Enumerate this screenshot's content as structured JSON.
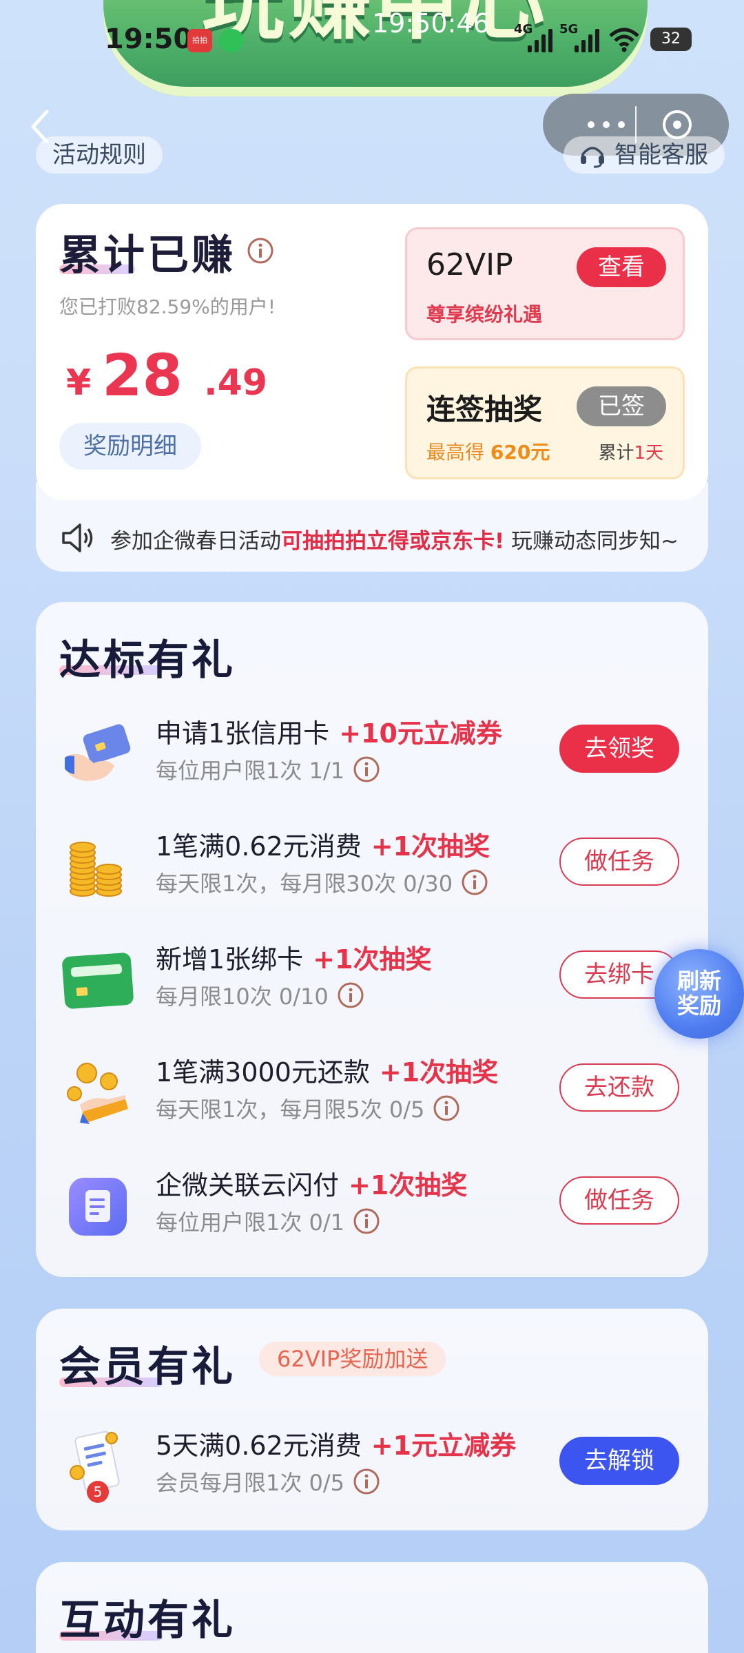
{
  "banner": {
    "title": "玩赚中心"
  },
  "status_bar": {
    "time": "19:50",
    "center_time": "19:50:46",
    "network_a": "4G",
    "network_b": "5G",
    "battery": "32",
    "app_badge_text": "拍拍"
  },
  "header": {
    "rules_label": "活动规则",
    "service_label": "智能客服"
  },
  "summary": {
    "title": "累计已赚",
    "beat_text": "您已打败82.59%的用户!",
    "currency": "¥",
    "amount_int": "28",
    "amount_dec": ".49",
    "detail_label": "奖励明细",
    "vip": {
      "name": "62VIP",
      "subtitle": "尊享缤纷礼遇",
      "button": "查看"
    },
    "sign": {
      "name": "连签抽奖",
      "button": "已签",
      "sub_prefix": "最高得",
      "sub_value": "620元",
      "total_prefix": "累计",
      "total_value": "1天"
    }
  },
  "notice": {
    "prefix": "参加企微春日活动",
    "highlight": "可抽拍拍立得或京东卡!",
    "suffix": "玩赚动态同步知~"
  },
  "standard": {
    "title": "达标有礼",
    "tasks": [
      {
        "title": "申请1张信用卡",
        "reward": "+10元立减券",
        "sub": "每位用户限1次 1/1",
        "button": "去领奖",
        "icon": "credit-card-hand-icon"
      },
      {
        "title": "1笔满0.62元消费",
        "reward": "+1次抽奖",
        "sub": "每天限1次，每月限30次 0/30",
        "button": "做任务",
        "icon": "gold-coins-icon"
      },
      {
        "title": "新增1张绑卡",
        "reward": "+1次抽奖",
        "sub": "每月限10次 0/10",
        "button": "去绑卡",
        "icon": "green-card-icon"
      },
      {
        "title": "1笔满3000元还款",
        "reward": "+1次抽奖",
        "sub": "每天限1次，每月限5次 0/5",
        "button": "去还款",
        "icon": "coin-hand-icon"
      },
      {
        "title": "企微关联云闪付",
        "reward": "+1次抽奖",
        "sub": "每位用户限1次 0/1",
        "button": "做任务",
        "icon": "document-app-icon"
      }
    ]
  },
  "refresh": {
    "line1": "刷新",
    "line2": "奖励"
  },
  "member": {
    "title": "会员有礼",
    "tag": "62VIP奖励加送",
    "task": {
      "title": "5天满0.62元消费",
      "reward": "+1元立减券",
      "sub": "会员每月限1次 0/5",
      "button": "去解锁",
      "badge": "5"
    }
  },
  "interactive": {
    "title": "互动有礼"
  },
  "colors": {
    "accent_red": "#ea2f48",
    "accent_blue": "#3d55f0",
    "bg": "#c9ddfa"
  }
}
